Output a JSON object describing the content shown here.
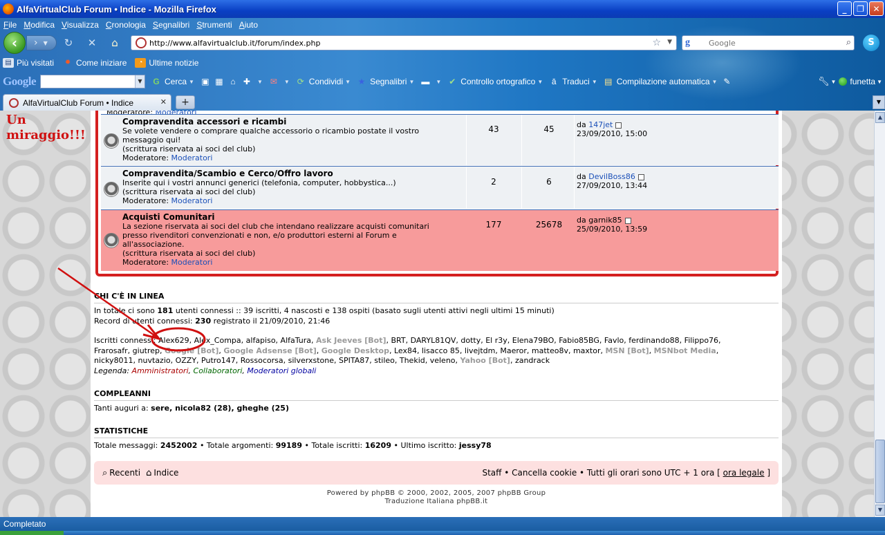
{
  "window": {
    "title": "AlfaVirtualClub Forum • Indice - Mozilla Firefox",
    "controls": [
      "_",
      "❐",
      "✕"
    ]
  },
  "menu": [
    "File",
    "Modifica",
    "Visualizza",
    "Cronologia",
    "Segnalibri",
    "Strumenti",
    "Aiuto"
  ],
  "nav": {
    "url": "http://www.alfavirtualclub.it/forum/index.php",
    "search_placeholder": "Google"
  },
  "bookmarks": [
    "Più visitati",
    "Come iniziare",
    "Ultime notizie"
  ],
  "google_toolbar": {
    "logo": "Google",
    "items": [
      "Cerca",
      "Condividi",
      "Segnalibri",
      "Controllo ortografico",
      "Traduci",
      "Compilazione automatica"
    ],
    "user": "funetta"
  },
  "tab": {
    "label": "AlfaVirtualClub Forum • Indice"
  },
  "forum": {
    "prev_moderator_label": "Moderatore:",
    "prev_moderator_link": "Moderatori",
    "rows": [
      {
        "title": "Compravendita accessori e ricambi",
        "desc1": "Se volete vendere o comprare qualche accessorio o ricambio postate il vostro",
        "desc2": "messaggio qui!",
        "desc3": "(scrittura riservata ai soci del club)",
        "mod_label": "Moderatore:",
        "mod_link": "Moderatori",
        "topics": "43",
        "posts": "45",
        "last_by": "da",
        "last_user": "147jet",
        "last_date": "23/09/2010, 15:00"
      },
      {
        "title": "Compravendita/Scambio e Cerco/Offro lavoro",
        "desc1": "Inserite qui i vostri annunci generici (telefonia, computer, hobbystica...)",
        "desc2": "(scrittura riservata ai soci del club)",
        "mod_label": "Moderatore:",
        "mod_link": "Moderatori",
        "topics": "2",
        "posts": "6",
        "last_by": "da",
        "last_user": "DevilBoss86",
        "last_date": "27/09/2010, 13:44"
      },
      {
        "title": "Acquisti Comunitari",
        "desc1": "La sezione riservata ai soci del club che intendano realizzare acquisti comunitari",
        "desc2": "presso rivenditori convenzionati e non, e/o produttori esterni al Forum e",
        "desc3": "all'associazione.",
        "desc4": "(scrittura riservata ai soci del club)",
        "mod_label": "Moderatore:",
        "mod_link": "Moderatori",
        "topics": "177",
        "posts": "25678",
        "last_by": "da",
        "last_user": "garnik85",
        "last_date": "25/09/2010, 13:59"
      }
    ],
    "online": {
      "heading": "CHI C'È IN LINEA",
      "line1_pre": "In totale ci sono ",
      "line1_num": "181",
      "line1_post": " utenti connessi :: 39 iscritti, 4 nascosti e 138 ospiti (basato sugli utenti attivi negli ultimi 15 minuti)",
      "line2_pre": "Record di utenti connessi: ",
      "line2_num": "230",
      "line2_post": " registrato il 21/09/2010, 21:46",
      "users_a": "Iscritti connessi: Alex629, Alex_Compa, alfapiso, AlfaTura, ",
      "bot1": "Ask Jeeves [Bot]",
      "users_b": ", BRT, DARYL81QV, dotty, El r3y, Elena79BO, Fabio85BG, Favlo, ferdinando88, Filippo76,",
      "users_c": "Frarosafr, giutrep, ",
      "bot2": "Google [Bot]",
      "sep1": ", ",
      "bot3": "Google Adsense [Bot]",
      "sep2": ", ",
      "bot4": "Google Desktop",
      "users_d": ", Lex84, lisacco 85, livejtdm, Maeror, matteo8v, maxtor, ",
      "bot5": "MSN [Bot]",
      "sep3": ", ",
      "bot6": "MSNbot Media",
      "users_e": ",",
      "users_f": "nicky8011, nuvtazio, OZZY, Putro147, Rossocorsa, silverxstone, SPITA87, stileo, Thekid, veleno, ",
      "bot7": "Yahoo [Bot]",
      "users_g": ", zandrack",
      "legend_label": "Legenda: ",
      "legend_admin": "Amministratori",
      "legend_coll": "Collaboratori",
      "legend_mod": "Moderatori globali"
    },
    "birthdays": {
      "heading": "COMPLEANNI",
      "pre": "Tanti auguri a: ",
      "names": "sere, nicola82 (28), gheghe (25)"
    },
    "stats": {
      "heading": "STATISTICHE",
      "t1": "Totale messaggi: ",
      "v1": "2452002",
      "t2": " • Totale argomenti: ",
      "v2": "99189",
      "t3": " • Totale iscritti: ",
      "v3": "16209",
      "t4": " • Ultimo iscritto: ",
      "v4": "jessy78"
    },
    "footer": {
      "recent": "Recenti",
      "index": "Indice",
      "right_pre": "Staff • Cancella cookie • Tutti gli orari sono UTC + 1 ora [ ",
      "right_link": "ora legale",
      "right_post": " ]"
    },
    "powered1_pre": "Powered by ",
    "powered1_link": "phpBB",
    "powered1_post": " © 2000, 2002, 2005, 2007 phpBB Group",
    "powered2_pre": "Traduzione Italiana ",
    "powered2_link": "phpBB.it"
  },
  "annotation": {
    "line1": "Un",
    "line2": "miraggio!!!",
    "color": "#d01010"
  },
  "status": {
    "text": "Completato"
  },
  "colors": {
    "accent": "#d42020",
    "link": "#1a4fb8",
    "highlight_row": "#f79b9b"
  }
}
